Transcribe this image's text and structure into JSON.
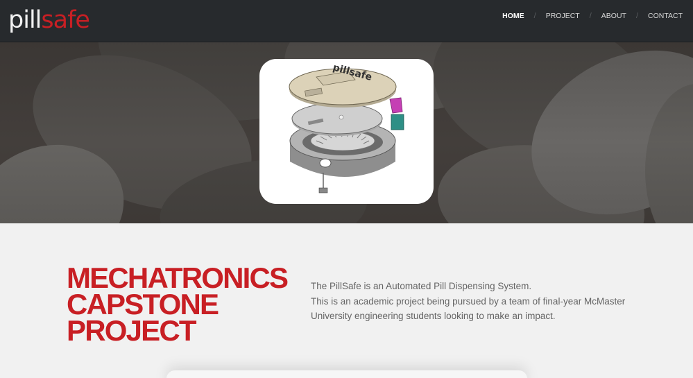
{
  "header": {
    "logo": {
      "part1": "pill",
      "part2": "safe"
    },
    "nav": [
      {
        "label": "HOME",
        "active": true
      },
      {
        "label": "PROJECT",
        "active": false
      },
      {
        "label": "ABOUT",
        "active": false
      },
      {
        "label": "CONTACT",
        "active": false
      }
    ]
  },
  "hero": {
    "image_label": "pillsafe"
  },
  "main": {
    "headline": [
      "MECHATRONICS",
      "CAPSTONE",
      "PROJECT"
    ],
    "description": [
      "The PillSafe is an Automated Pill Dispensing System.",
      "This is an academic project being pursued by a team of final-year McMaster",
      "University engineering students looking to make an impact."
    ]
  },
  "colors": {
    "accent": "#c81f24",
    "navbar": "#272a2d",
    "background": "#f1f1f1",
    "text": "#646464"
  }
}
